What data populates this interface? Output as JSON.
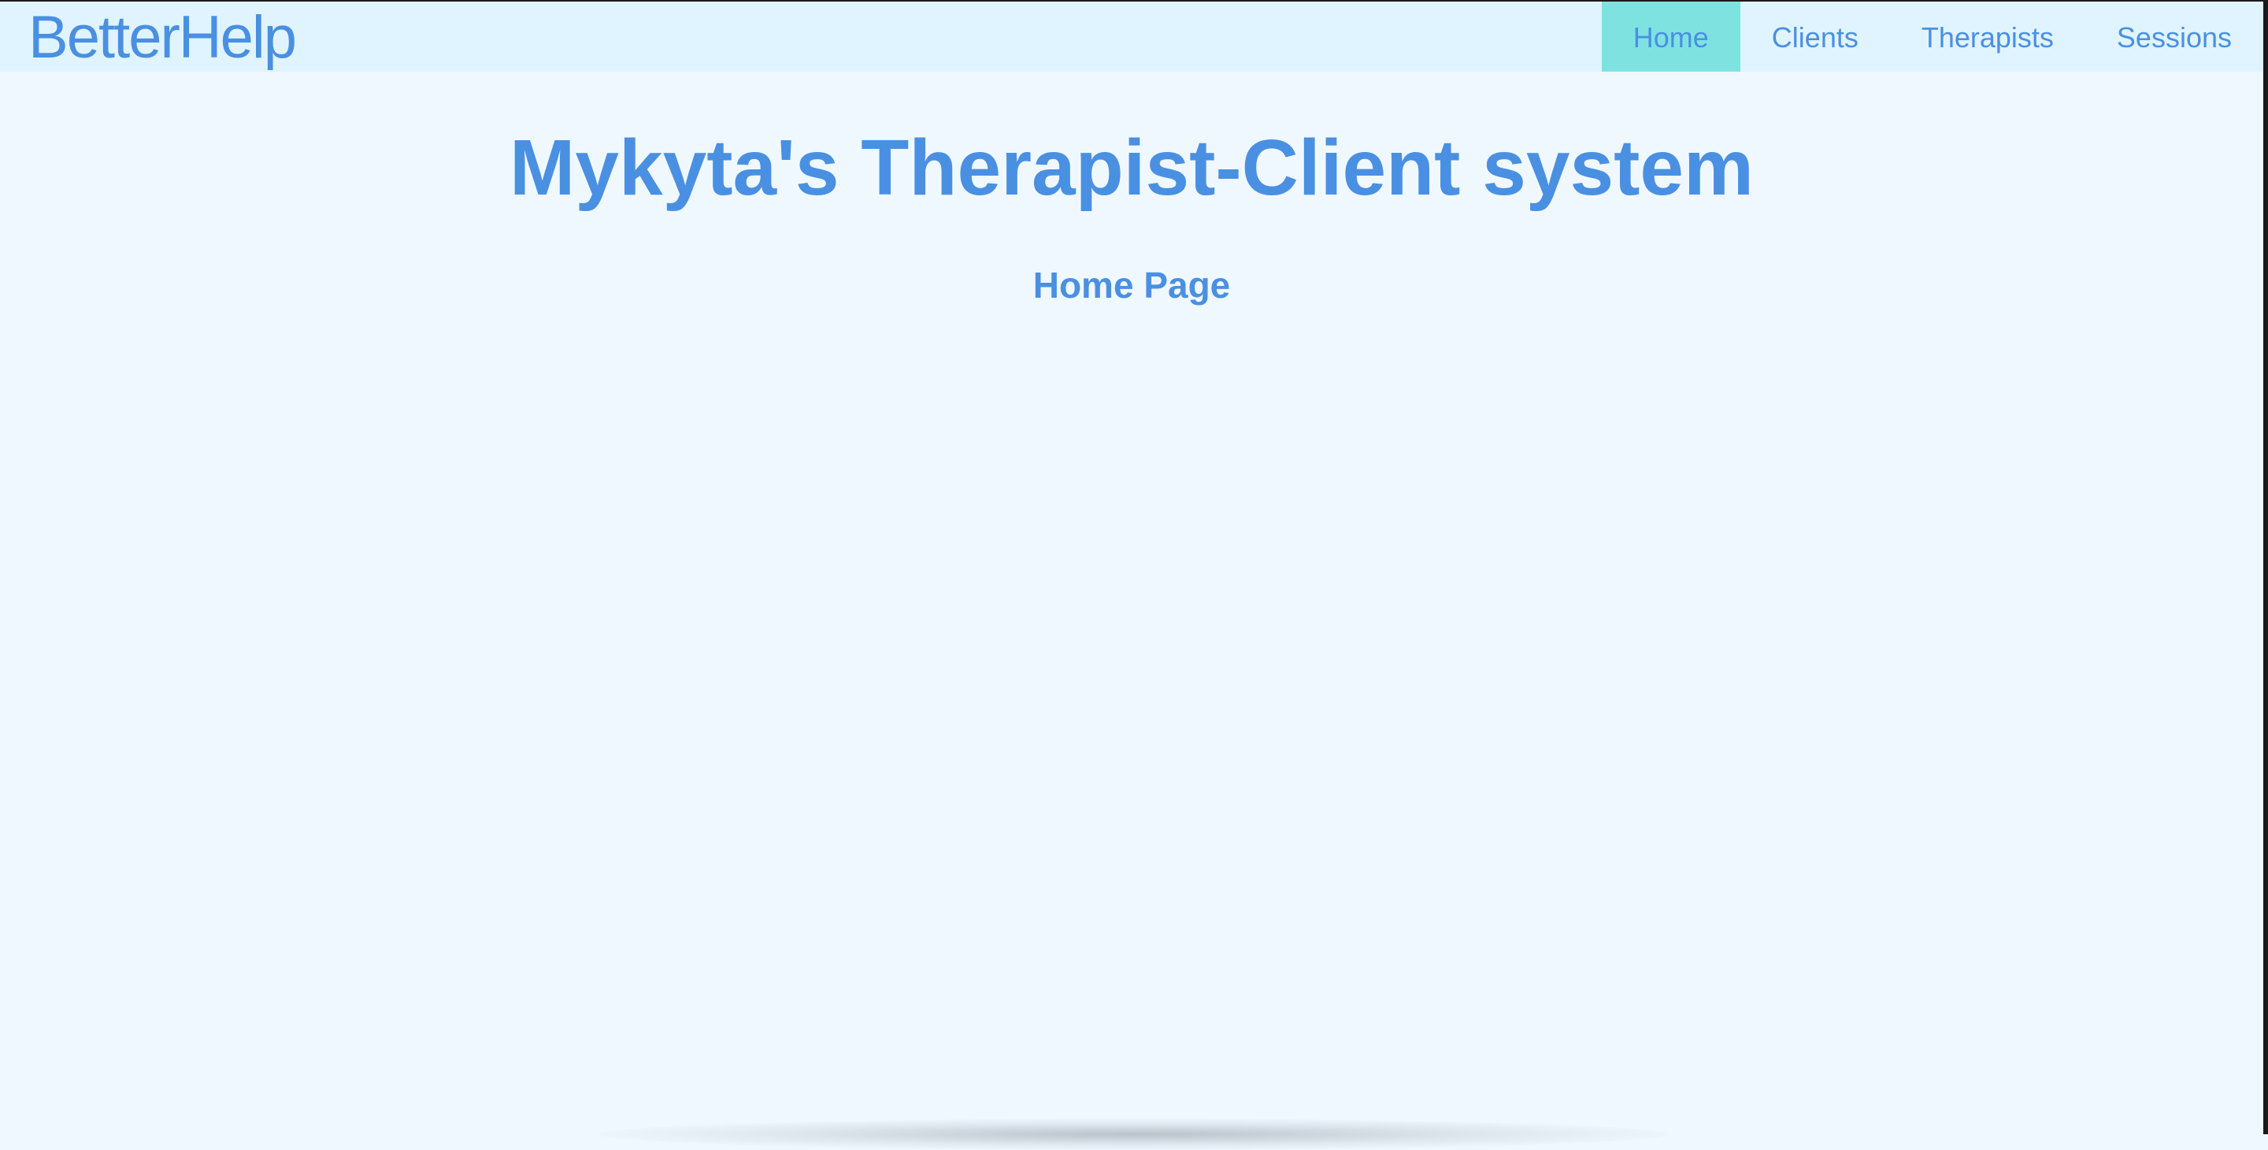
{
  "navbar": {
    "brand": "BetterHelp",
    "links": [
      {
        "label": "Home",
        "active": true
      },
      {
        "label": "Clients",
        "active": false
      },
      {
        "label": "Therapists",
        "active": false
      },
      {
        "label": "Sessions",
        "active": false
      }
    ]
  },
  "main": {
    "title": "Mykyta's Therapist-Client system",
    "subtitle": "Home Page"
  },
  "colors": {
    "background": "#f0f8ff",
    "navbar_background": "#e0f4ff",
    "accent": "#4a90e2",
    "active_tab": "#7ee3e0"
  }
}
